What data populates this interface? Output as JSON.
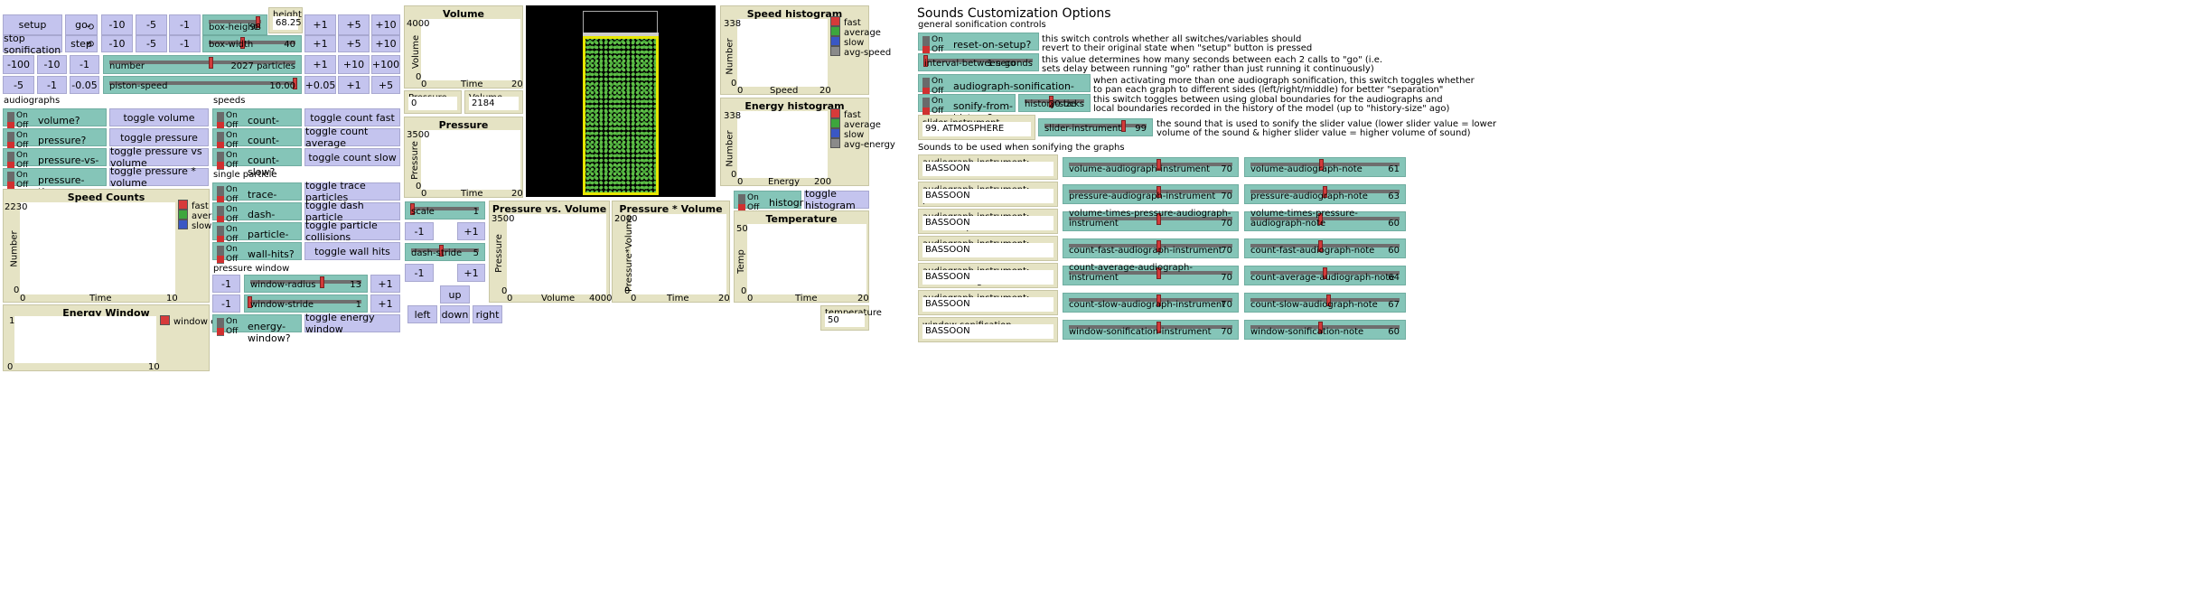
{
  "top_controls": {
    "setup": "setup",
    "go": "go",
    "forever_icon": "⟲",
    "stop_sonification": "stop sonification",
    "step": "step",
    "row1": [
      "-10",
      "-5",
      "-1"
    ],
    "row1_plus": [
      "+1",
      "+5",
      "+10"
    ],
    "row2": [
      "-10",
      "-5",
      "-1"
    ],
    "row2_plus": [
      "+1",
      "+5",
      "+10"
    ],
    "row3": [
      "-100",
      "-10",
      "-1"
    ],
    "row3_plus": [
      "+1",
      "+10",
      "+100"
    ],
    "row4": [
      "-5",
      "-1",
      "-0.05"
    ],
    "row4_plus": [
      "+0.05",
      "+1",
      "+5"
    ],
    "box_height_label": "box-height",
    "box_height_value": "98",
    "box_height_level": 0.95,
    "box_width_label": "box-width",
    "box_width_value": "40",
    "box_width_level": 0.4,
    "number_label": "number",
    "number_value": "2027 particles",
    "number_level": 0.55,
    "piston_speed_label": "piston-speed",
    "piston_speed_value": "10.00",
    "piston_speed_level": 1.0,
    "height_label": "height",
    "height_value": "68.25"
  },
  "audiographs": {
    "header": "audiographs",
    "items": [
      {
        "switch": "volume?",
        "button": "toggle volume"
      },
      {
        "switch": "pressure?",
        "button": "toggle pressure"
      },
      {
        "switch": "pressure-vs-volume?",
        "button": "toggle pressure vs volume"
      },
      {
        "switch": "pressure-times-volume?",
        "button": "toggle pressure * volume"
      }
    ]
  },
  "switch_on": "On",
  "switch_off": "Off",
  "speeds": {
    "header": "speeds",
    "items": [
      {
        "switch": "count-fast?",
        "button": "toggle count fast"
      },
      {
        "switch": "count-average?",
        "button": "toggle count average"
      },
      {
        "switch": "count-slow?",
        "button": "toggle count slow"
      }
    ]
  },
  "single_particle": {
    "header": "single particle",
    "items": [
      {
        "switch": "trace-particle?",
        "button": "toggle trace particles"
      },
      {
        "switch": "dash-particle?",
        "button": "toggle dash particle"
      },
      {
        "switch": "particle-collisions?",
        "button": "toggle particle collisions"
      },
      {
        "switch": "wall-hits?",
        "button": "toggle wall hits"
      }
    ]
  },
  "pressure_window": {
    "header": "pressure window",
    "minus": "-1",
    "plus": "+1",
    "radius_label": "window-radius",
    "radius_value": "13",
    "radius_level": 0.65,
    "stride_label": "window-stride",
    "stride_value": "1",
    "stride_level": 0.0,
    "energy_switch": "energy-window?",
    "energy_button": "toggle energy window"
  },
  "speed_counts": {
    "title": "Speed Counts",
    "ymax": "2230",
    "ymin": "0",
    "xmin": "0",
    "xmax": "10",
    "xlabel": "Time",
    "ylabel": "Number",
    "legend": [
      {
        "name": "fast",
        "color": "#d73a3a"
      },
      {
        "name": "average",
        "color": "#3da63d"
      },
      {
        "name": "slow",
        "color": "#3a57c4"
      }
    ]
  },
  "energy_window": {
    "title": "Energy Window",
    "ymax": "1",
    "ymin": "0",
    "xmin": "0",
    "xmax": "10",
    "legend": [
      {
        "name": "window energy",
        "color": "#d73a3a"
      }
    ]
  },
  "volume_plot": {
    "title": "Volume",
    "ymax": "4000",
    "ymin": "0",
    "xmin": "0",
    "xmax": "20",
    "xlabel": "Time",
    "ylabel": "Volume"
  },
  "pressure_monitor": {
    "label": "Pressure",
    "value": "0"
  },
  "volume_monitor": {
    "label": "Volume",
    "value": "2184"
  },
  "pressure_plot": {
    "title": "Pressure",
    "ymax": "3500",
    "ymin": "0",
    "xmin": "0",
    "xmax": "20",
    "xlabel": "Time",
    "ylabel": "Pressure"
  },
  "view_controls": {
    "scale_label": "scale",
    "scale_value": "1",
    "scale_level": 0.02,
    "dash_label": "dash-stride",
    "dash_value": "5",
    "dash_level": 0.45,
    "minus": "-1",
    "plus": "+1",
    "up": "up",
    "left": "left",
    "down": "down",
    "right": "right"
  },
  "pv_plot": {
    "title": "Pressure vs. Volume",
    "ymax": "3500",
    "ymin": "0",
    "xmin": "0",
    "xmax": "4000",
    "xlabel": "Volume",
    "ylabel": "Pressure"
  },
  "ptv_plot": {
    "title": "Pressure * Volume",
    "ymax": "2000",
    "ymin": "0",
    "xmin": "0",
    "xmax": "20",
    "xlabel": "Time",
    "ylabel": "Pressure*Volume"
  },
  "speed_hist": {
    "title": "Speed histogram",
    "ymax": "338",
    "ymin": "0",
    "xmin": "0",
    "xmax": "20",
    "xlabel": "Speed",
    "ylabel": "Number",
    "legend": [
      {
        "name": "fast",
        "color": "#d73a3a"
      },
      {
        "name": "average",
        "color": "#3da63d"
      },
      {
        "name": "slow",
        "color": "#3a57c4"
      },
      {
        "name": "avg-speed",
        "color": "#8a8a8a"
      }
    ]
  },
  "energy_hist": {
    "title": "Energy histogram",
    "ymax": "338",
    "ymin": "0",
    "xmin": "0",
    "xmax": "200",
    "xlabel": "Energy",
    "ylabel": "Number",
    "legend": [
      {
        "name": "fast",
        "color": "#d73a3a"
      },
      {
        "name": "average",
        "color": "#3da63d"
      },
      {
        "name": "slow",
        "color": "#3a57c4"
      },
      {
        "name": "avg-energy",
        "color": "#8a8a8a"
      }
    ]
  },
  "histogram_switch": "histogram?",
  "histogram_button": "toggle histogram",
  "temperature_plot": {
    "title": "Temperature",
    "ymax": "50",
    "ymin": "0",
    "xmin": "0",
    "xmax": "20",
    "xlabel": "Time",
    "ylabel": "Temp"
  },
  "temperature_monitor": {
    "label": "temperature",
    "value": "50"
  },
  "sound_options": {
    "title": "Sounds Customization Options",
    "general": "general sonification controls",
    "reset_switch": "reset-on-setup?",
    "reset_note1": "this switch controls whether all switches/variables should",
    "reset_note2": "revert to their original state when \"setup\" button is pressed",
    "interval_label": "interval-between-go",
    "interval_value": "1 seconds",
    "interval_level": 0.02,
    "interval_note1": "this value determines how many seconds between each 2 calls to \"go\" (i.e.",
    "interval_note2": "sets delay between running \"go\" rather than just running it continuously)",
    "orientation_switch": "audiograph-sonification-orientation?",
    "orientation_note1": "when activating more than one audiograph sonification, this switch toggles whether",
    "orientation_note2": "to pan each graph to different sides (left/right/middle) for better \"separation\"",
    "history_switch": "sonify-from-history?",
    "history_label": "history-size",
    "history_value": "20 ticks",
    "history_level": 0.45,
    "history_note1": "this switch toggles between using global boundaries for the audiographs and",
    "history_note2": "local boundaries recorded in the history of the model (up to \"history-size\" ago)",
    "slider_instr_label": "slider instrument",
    "slider_instr_value": "99. ATMOSPHERE",
    "slider_instr_slider_label": "slider-instrument",
    "slider_instr_slider_value": "99",
    "slider_instr_level": 0.78,
    "slider_note1": "the sound that is used to sonify the slider value (lower slider value = lower",
    "slider_note2": "volume of the sound & higher slider value = higher volume of sound)",
    "sounds_header": "Sounds to be used when sonifying the graphs",
    "rows": [
      {
        "chooser": "audiograph instrument: volume",
        "instrument": "BASSOON",
        "inst_label": "volume-audiograph-instrument",
        "inst_value": "70",
        "inst_level": 0.55,
        "note_label": "volume-audiograph-note",
        "note_value": "61",
        "note_level": 0.48
      },
      {
        "chooser": "audiograph instrument: pressure",
        "instrument": "BASSOON",
        "inst_label": "pressure-audiograph-instrument",
        "inst_value": "70",
        "inst_level": 0.55,
        "note_label": "pressure-audiograph-note",
        "note_value": "63",
        "note_level": 0.5
      },
      {
        "chooser": "audiograph instrument: volume * pressure",
        "instrument": "BASSOON",
        "inst_label": "volume-times-pressure-audiograph-instrument",
        "inst_value": "70",
        "inst_level": 0.55,
        "note_label": "volume-times-pressure-audiograph-note",
        "note_value": "60",
        "note_level": 0.47
      },
      {
        "chooser": "audiograph instrument: count fast",
        "instrument": "BASSOON",
        "inst_label": "count-fast-audiograph-instrument",
        "inst_value": "70",
        "inst_level": 0.55,
        "note_label": "count-fast-audiograph-note",
        "note_value": "60",
        "note_level": 0.47
      },
      {
        "chooser": "audiograph instrument: count average",
        "instrument": "BASSOON",
        "inst_label": "count-average-audiograph-instrument",
        "inst_value": "70",
        "inst_level": 0.55,
        "note_label": "count-average-audiograph-note",
        "note_value": "64",
        "note_level": 0.5
      },
      {
        "chooser": "audiograph instrument: count slow",
        "instrument": "BASSOON",
        "inst_label": "count-slow-audiograph-instrument",
        "inst_value": "70",
        "inst_level": 0.55,
        "note_label": "count-slow-audiograph-note",
        "note_value": "67",
        "note_level": 0.53
      },
      {
        "chooser": "window sonification instrument",
        "instrument": "BASSOON",
        "inst_label": "window-sonification-instrument",
        "inst_value": "70",
        "inst_level": 0.55,
        "note_label": "window-sonification-note",
        "note_value": "60",
        "note_level": 0.47
      }
    ]
  },
  "colors": {
    "button": "#c4c4ee",
    "switch": "#85c5b8",
    "monitor": "#e5e3c4",
    "particle": "#4caf3c",
    "box_wall": "#e6e600"
  }
}
